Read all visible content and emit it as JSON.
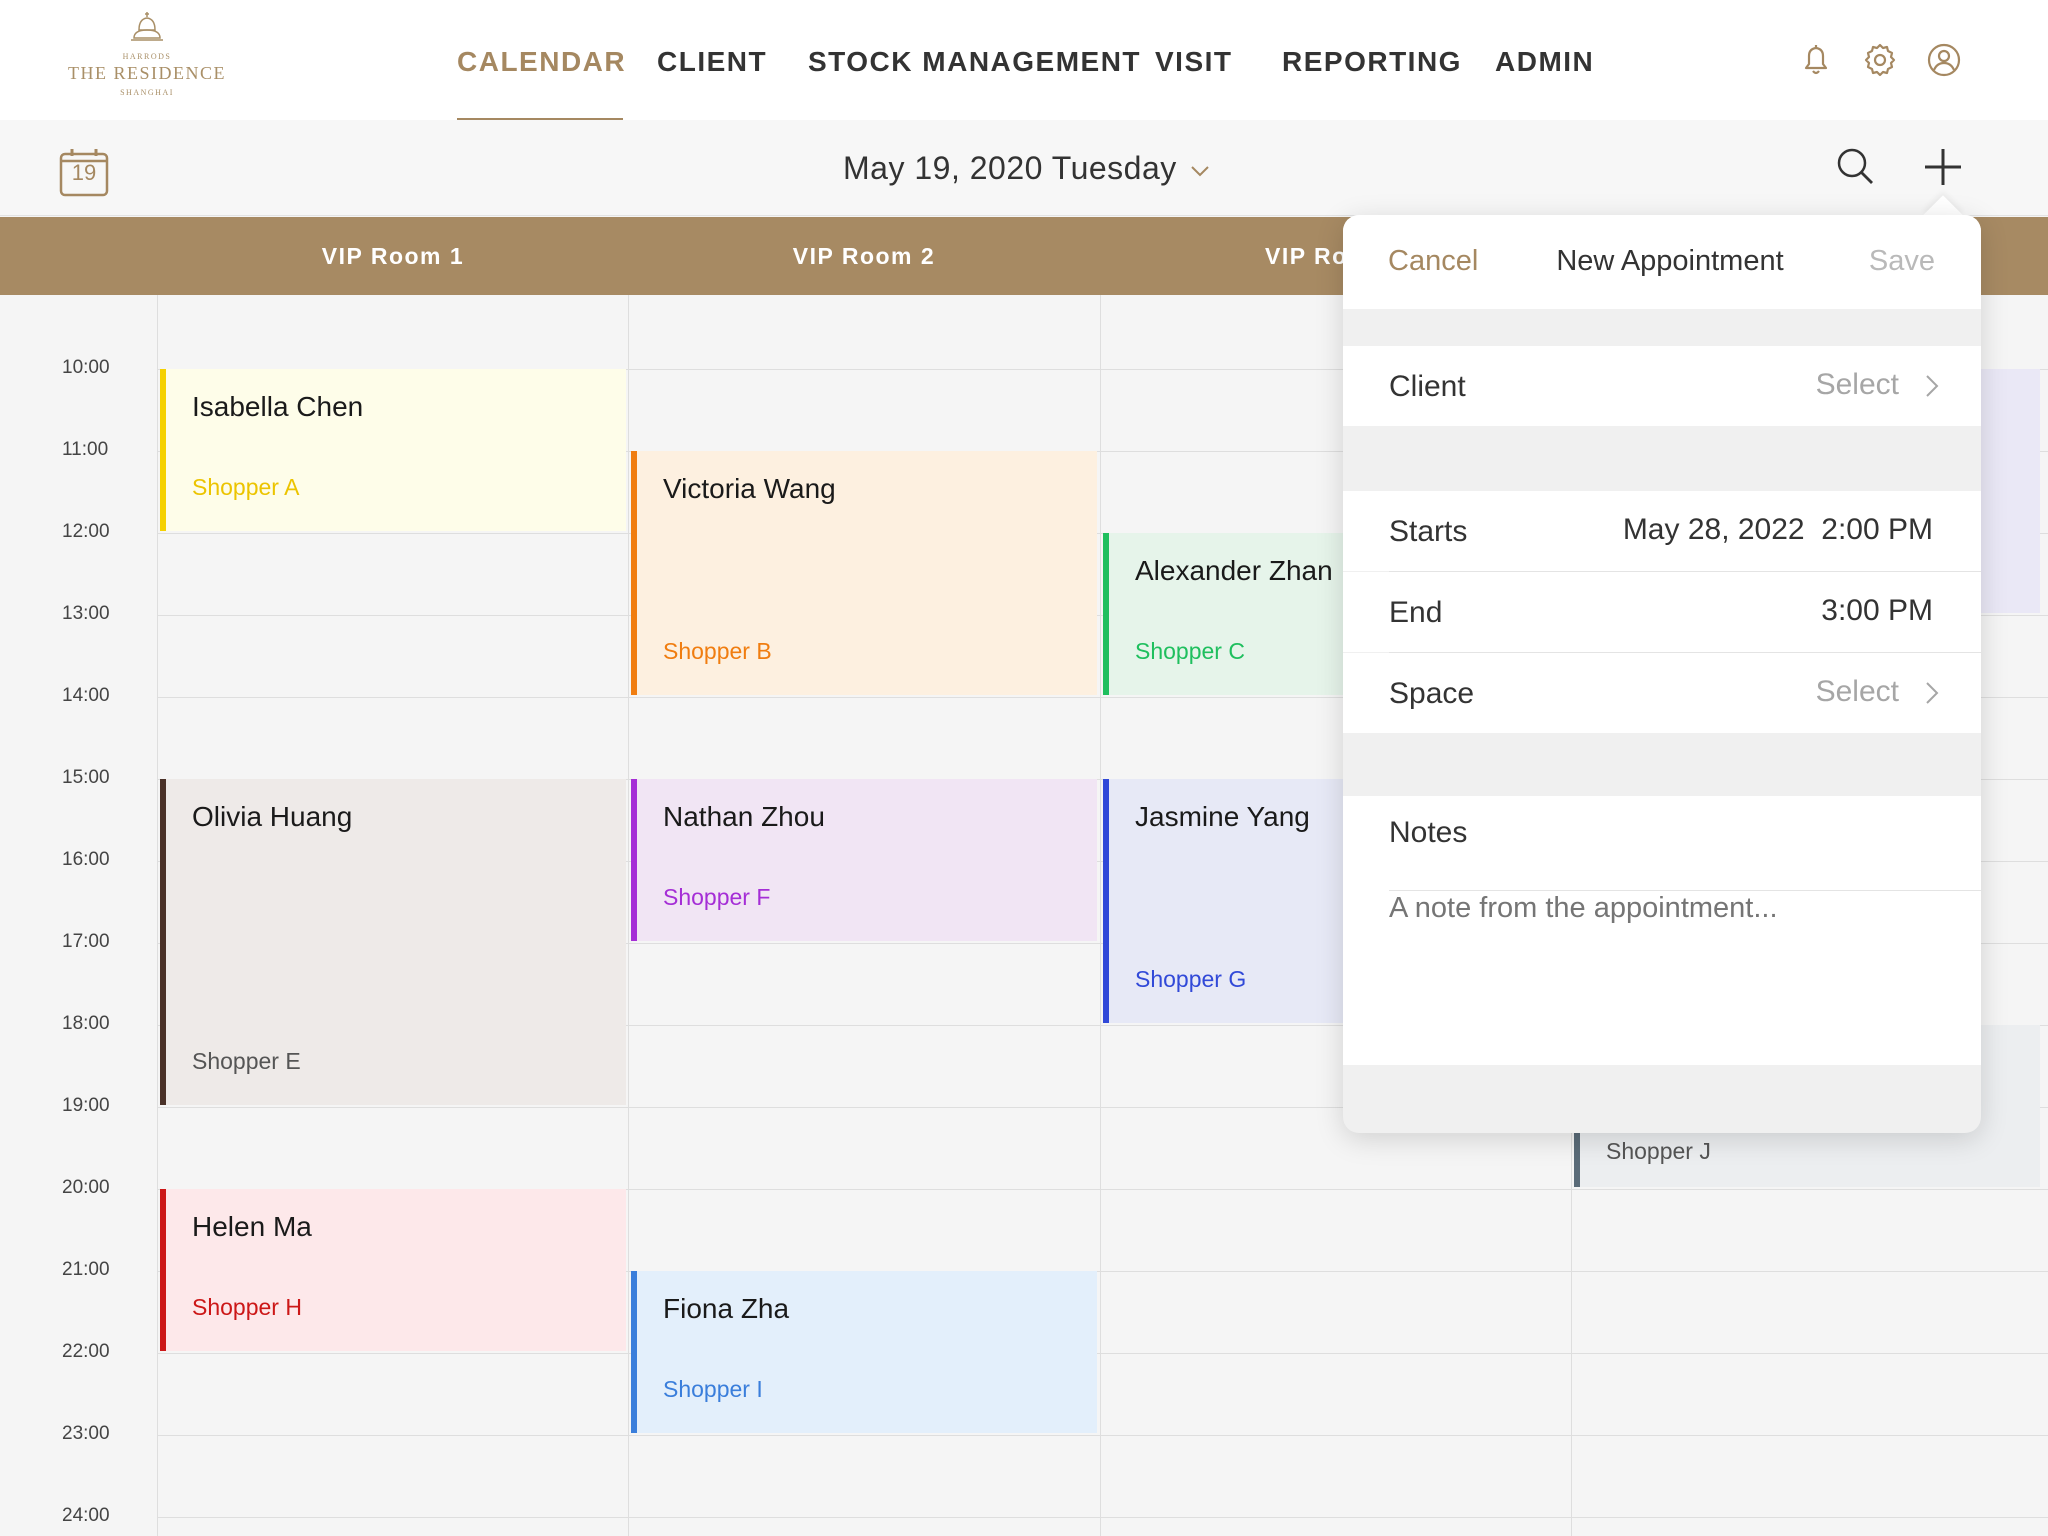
{
  "logo": {
    "brand": "HARRODS",
    "name": "THE RESIDENCE",
    "city": "SHANGHAI"
  },
  "nav": {
    "items": [
      "CALENDAR",
      "CLIENT",
      "STOCK MANAGEMENT",
      "VISIT",
      "REPORTING",
      "ADMIN"
    ],
    "active": "CALENDAR"
  },
  "toolbar": {
    "calendar_day": "19",
    "date_label": "May 19, 2020 Tuesday"
  },
  "rooms": [
    "VIP Room 1",
    "VIP Room 2",
    "VIP Ro"
  ],
  "times": [
    "10:00",
    "11:00",
    "12:00",
    "13:00",
    "14:00",
    "15:00",
    "16:00",
    "17:00",
    "18:00",
    "19:00",
    "20:00",
    "21:00",
    "22:00",
    "23:00",
    "24:00"
  ],
  "events": [
    {
      "client": "Isabella Chen",
      "shopper": "Shopper A",
      "room": "VIP Room 1",
      "start": "10:00",
      "end": "12:00",
      "color": "#f5d100",
      "bg": "#fefde9"
    },
    {
      "client": "Victoria Wang",
      "shopper": "Shopper B",
      "room": "VIP Room 2",
      "start": "11:00",
      "end": "14:00",
      "color": "#f07d10",
      "bg": "#fdf0e0"
    },
    {
      "client": "Alexander Zhan",
      "shopper": "Shopper C",
      "room": "VIP Room 3",
      "start": "12:00",
      "end": "14:00",
      "color": "#1fbf5e",
      "bg": "#e6f4ea"
    },
    {
      "client": "Olivia Huang",
      "shopper": "Shopper E",
      "room": "VIP Room 1",
      "start": "15:00",
      "end": "19:00",
      "color": "#4a3128",
      "bg": "#eeeae8"
    },
    {
      "client": "Nathan Zhou",
      "shopper": "Shopper F",
      "room": "VIP Room 2",
      "start": "15:00",
      "end": "17:00",
      "color": "#a52ed6",
      "bg": "#f1e5f4"
    },
    {
      "client": "Jasmine Yang",
      "shopper": "Shopper G",
      "room": "VIP Room 3",
      "start": "15:00",
      "end": "18:00",
      "color": "#3149d8",
      "bg": "#e7e9f6"
    },
    {
      "client": "Helen Ma",
      "shopper": "Shopper H",
      "room": "VIP Room 1",
      "start": "20:00",
      "end": "22:00",
      "color": "#cc1717",
      "bg": "#fde8ea"
    },
    {
      "client": "Fiona Zha",
      "shopper": "Shopper I",
      "room": "VIP Room 2",
      "start": "21:00",
      "end": "23:00",
      "color": "#3a7edb",
      "bg": "#e3effb"
    },
    {
      "client": "",
      "shopper": "Shopper J",
      "room": "VIP Room 4",
      "start": "18:00",
      "end": "20:00",
      "color": "#5a6b78",
      "bg": "#eceef0"
    },
    {
      "client": "",
      "shopper": "",
      "room": "VIP Room 4",
      "start": "10:00",
      "end": "13:00",
      "color": "#c9c3ea",
      "bg": "#eae8f6"
    }
  ],
  "popover": {
    "cancel": "Cancel",
    "title": "New Appointment",
    "save": "Save",
    "client_label": "Client",
    "client_value": "Select",
    "starts_label": "Starts",
    "starts_value": "May 28, 2022  2:00 PM",
    "end_label": "End",
    "end_value": "3:00 PM",
    "space_label": "Space",
    "space_value": "Select",
    "notes_label": "Notes",
    "notes_placeholder": "A note from the appointment..."
  }
}
